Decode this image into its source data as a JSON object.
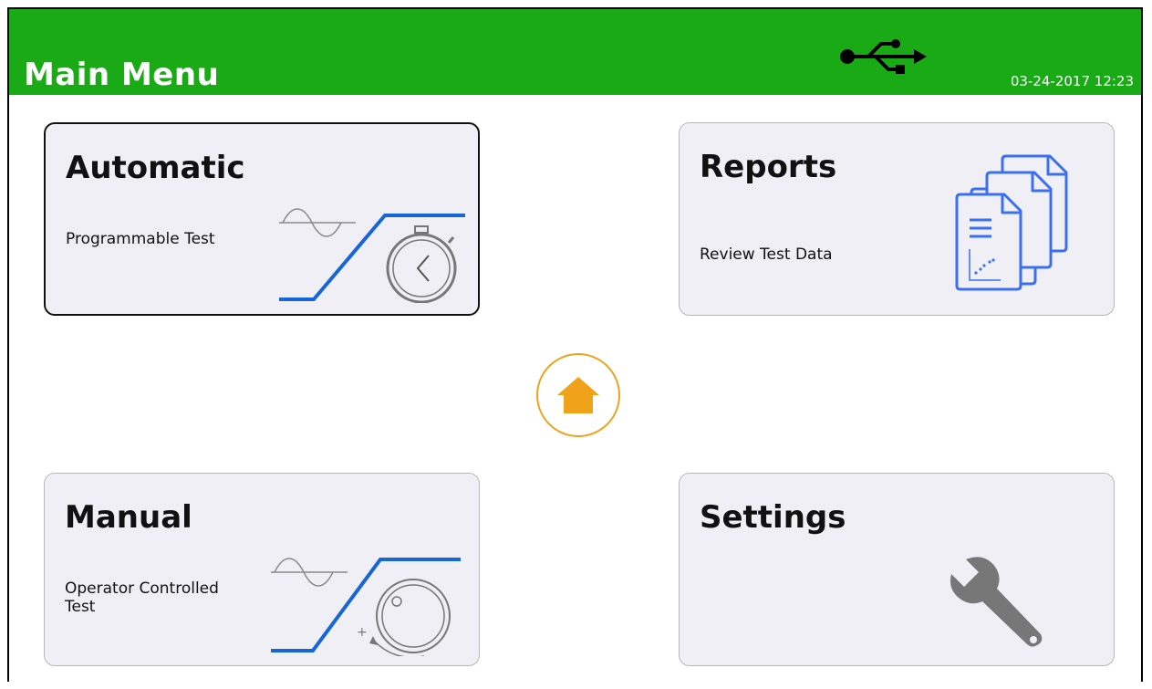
{
  "header": {
    "title": "Main Menu",
    "datetime": "03-24-2017 12:23",
    "status_icon": "usb-icon",
    "background_color": "#1aaa16"
  },
  "cards": {
    "automatic": {
      "title": "Automatic",
      "subtitle": "Programmable Test",
      "icon": "timer-ramp-icon",
      "selected": true
    },
    "reports": {
      "title": "Reports",
      "subtitle": "Review Test Data",
      "icon": "documents-icon"
    },
    "manual": {
      "title": "Manual",
      "subtitle": "Operator Controlled Test",
      "icon": "knob-ramp-icon"
    },
    "settings": {
      "title": "Settings",
      "subtitle": "",
      "icon": "wrench-icon"
    }
  },
  "home_button": {
    "icon": "home-icon",
    "color": "#f0a21b"
  },
  "colors": {
    "accent_blue": "#1666d8",
    "icon_gray": "#777777",
    "card_bg": "#f0eff5"
  }
}
